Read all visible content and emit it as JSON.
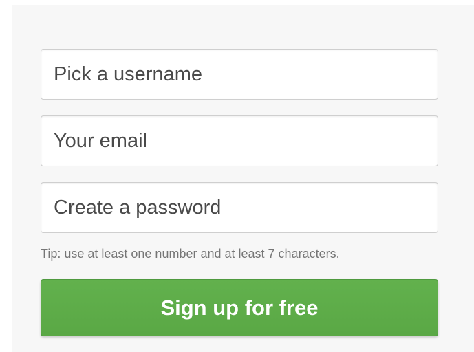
{
  "form": {
    "username_placeholder": "Pick a username",
    "email_placeholder": "Your email",
    "password_placeholder": "Create a password",
    "tip": "Tip: use at least one number and at least 7 characters.",
    "submit_label": "Sign up for free"
  },
  "colors": {
    "panel_background": "#f7f7f7",
    "button_green": "#5ca947",
    "button_text": "#ffffff",
    "tip_text": "#767676"
  }
}
